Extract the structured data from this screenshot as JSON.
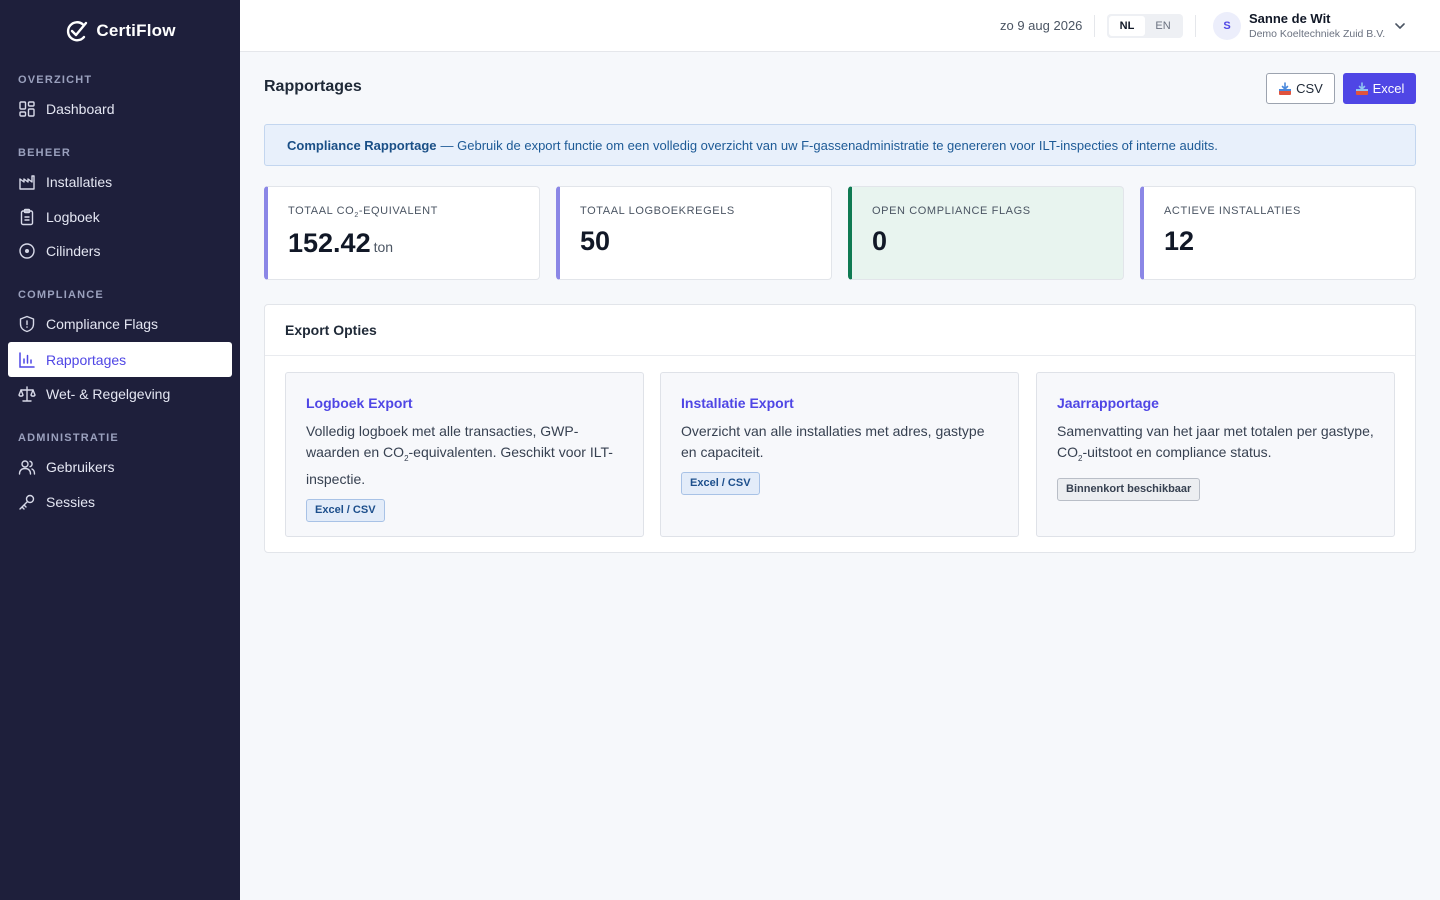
{
  "app": {
    "name": "CertiFlow"
  },
  "sidebar": {
    "sections": [
      {
        "label": "OVERZICHT",
        "items": [
          {
            "label": "Dashboard",
            "icon": "dashboard-icon"
          }
        ]
      },
      {
        "label": "BEHEER",
        "items": [
          {
            "label": "Installaties",
            "icon": "factory-icon"
          },
          {
            "label": "Logboek",
            "icon": "clipboard-icon"
          },
          {
            "label": "Cilinders",
            "icon": "cylinder-icon"
          }
        ]
      },
      {
        "label": "COMPLIANCE",
        "items": [
          {
            "label": "Compliance Flags",
            "icon": "shield-icon"
          },
          {
            "label": "Rapportages",
            "icon": "bar-chart-icon",
            "active": true
          },
          {
            "label": "Wet- & Regelgeving",
            "icon": "scale-icon"
          }
        ]
      },
      {
        "label": "ADMINISTRATIE",
        "items": [
          {
            "label": "Gebruikers",
            "icon": "users-icon"
          },
          {
            "label": "Sessies",
            "icon": "key-icon"
          }
        ]
      }
    ]
  },
  "topbar": {
    "date": "zo 9 aug 2026",
    "languages": [
      "NL",
      "EN"
    ],
    "active_language": "NL",
    "user": {
      "initial": "S",
      "name": "Sanne de Wit",
      "org": "Demo Koeltechniek Zuid B.V."
    }
  },
  "page": {
    "title": "Rapportages",
    "buttons": {
      "csv": "CSV",
      "excel": "Excel"
    },
    "info": {
      "title": "Compliance Rapportage",
      "text": "— Gebruik de export functie om een volledig overzicht van uw F-gassenadministratie te genereren voor ILT-inspecties of interne audits."
    },
    "stats": [
      {
        "label_prefix": "TOTAAL CO",
        "label_sub": "2",
        "label_suffix": "-EQUIVALENT",
        "value": "152.42",
        "unit": "ton"
      },
      {
        "label": "TOTAAL LOGBOEKREGELS",
        "value": "50"
      },
      {
        "label": "OPEN COMPLIANCE FLAGS",
        "value": "0"
      },
      {
        "label": "ACTIEVE INSTALLATIES",
        "value": "12"
      }
    ],
    "export": {
      "title": "Export Opties",
      "cards": [
        {
          "title": "Logboek Export",
          "desc_1": "Volledig logboek met alle transacties, GWP-waarden en CO",
          "desc_sub": "2",
          "desc_2": "-equivalenten. Geschikt voor ILT-inspectie.",
          "tag": "Excel / CSV"
        },
        {
          "title": "Installatie Export",
          "desc": "Overzicht van alle installaties met adres, gastype en capaciteit.",
          "tag": "Excel / CSV"
        },
        {
          "title": "Jaarrapportage",
          "desc_1": "Samenvatting van het jaar met totalen per gastype, CO",
          "desc_sub": "2",
          "desc_2": "-uitstoot en compliance status.",
          "tag": "Binnenkort beschikbaar"
        }
      ]
    }
  },
  "colors": {
    "sidebar_bg": "#1e1f3b",
    "accent": "#4f46e5",
    "success": "#0f7a52"
  }
}
